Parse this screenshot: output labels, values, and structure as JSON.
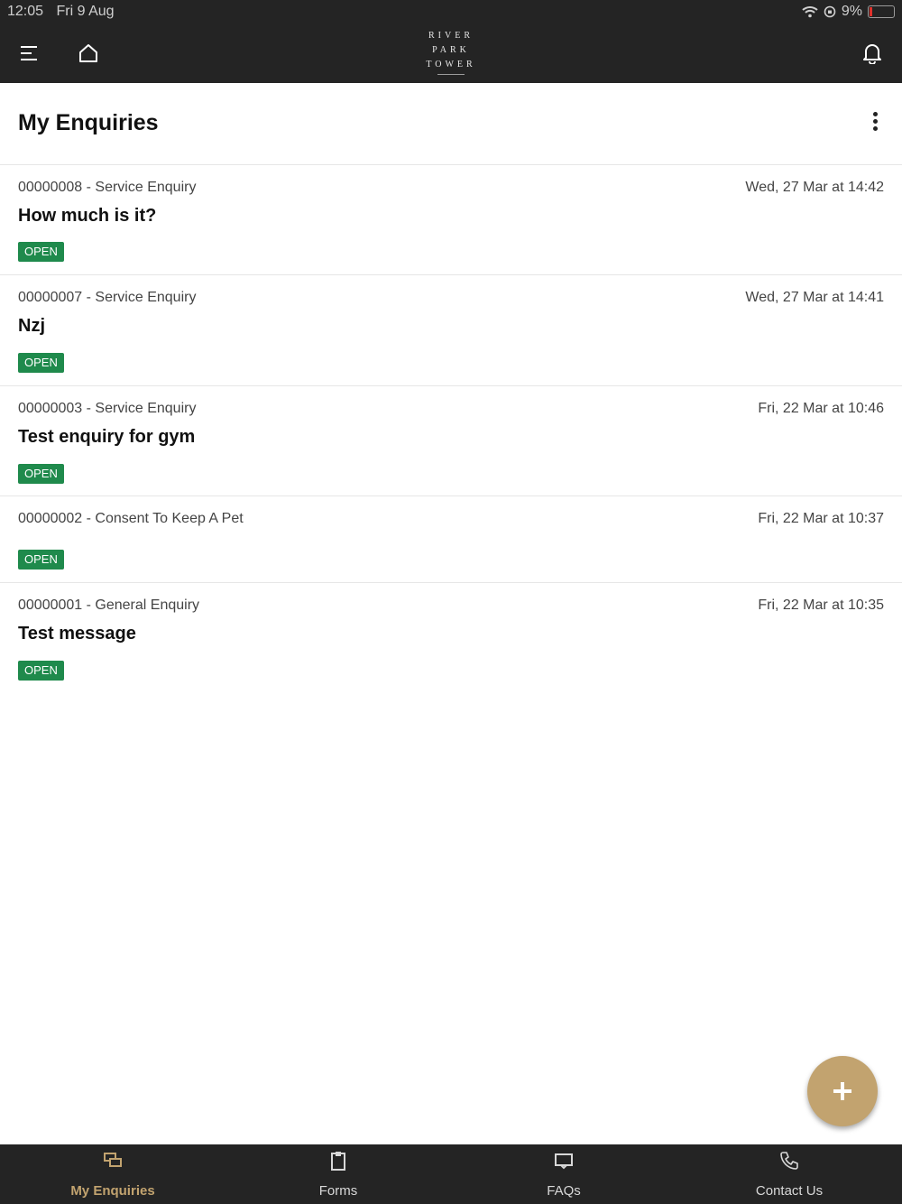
{
  "status_bar": {
    "time": "12:05",
    "date": "Fri 9 Aug",
    "battery": "9%"
  },
  "header": {
    "logo_lines": [
      "RIVER",
      "PARK",
      "TOWER"
    ]
  },
  "page": {
    "title": "My Enquiries"
  },
  "enquiries": [
    {
      "ref": "00000008 - Service Enquiry",
      "date": "Wed, 27 Mar at 14:42",
      "subject": "How much is it?",
      "status": "OPEN"
    },
    {
      "ref": "00000007 - Service Enquiry",
      "date": "Wed, 27 Mar at 14:41",
      "subject": "Nzj",
      "status": "OPEN"
    },
    {
      "ref": "00000003 - Service Enquiry",
      "date": "Fri, 22 Mar at 10:46",
      "subject": "Test enquiry for gym",
      "status": "OPEN"
    },
    {
      "ref": "00000002 - Consent To Keep A Pet",
      "date": "Fri, 22 Mar at 10:37",
      "subject": "",
      "status": "OPEN"
    },
    {
      "ref": "00000001 - General Enquiry",
      "date": "Fri, 22 Mar at 10:35",
      "subject": "Test message",
      "status": "OPEN"
    }
  ],
  "tabs": [
    {
      "label": "My Enquiries",
      "icon": "enquiries-icon",
      "active": true
    },
    {
      "label": "Forms",
      "icon": "clipboard-icon",
      "active": false
    },
    {
      "label": "FAQs",
      "icon": "message-icon",
      "active": false
    },
    {
      "label": "Contact Us",
      "icon": "phone-icon",
      "active": false
    }
  ],
  "colors": {
    "bar_bg": "#242424",
    "accent": "#c2a36f",
    "status_open": "#1f8a4c",
    "battery_low": "#e0312b"
  }
}
